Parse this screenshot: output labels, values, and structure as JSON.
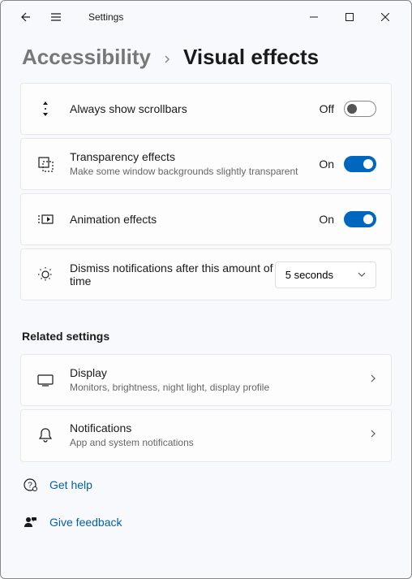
{
  "app": {
    "title": "Settings"
  },
  "breadcrumb": {
    "parent": "Accessibility",
    "current": "Visual effects"
  },
  "settings": {
    "scrollbars": {
      "title": "Always show scrollbars",
      "state_label": "Off",
      "state": false
    },
    "transparency": {
      "title": "Transparency effects",
      "desc": "Make some window backgrounds slightly transparent",
      "state_label": "On",
      "state": true
    },
    "animation": {
      "title": "Animation effects",
      "state_label": "On",
      "state": true
    },
    "dismiss": {
      "title": "Dismiss notifications after this amount of time",
      "value": "5 seconds"
    }
  },
  "related": {
    "header": "Related settings",
    "display": {
      "title": "Display",
      "desc": "Monitors, brightness, night light, display profile"
    },
    "notifications": {
      "title": "Notifications",
      "desc": "App and system notifications"
    }
  },
  "links": {
    "help": "Get help",
    "feedback": "Give feedback"
  }
}
